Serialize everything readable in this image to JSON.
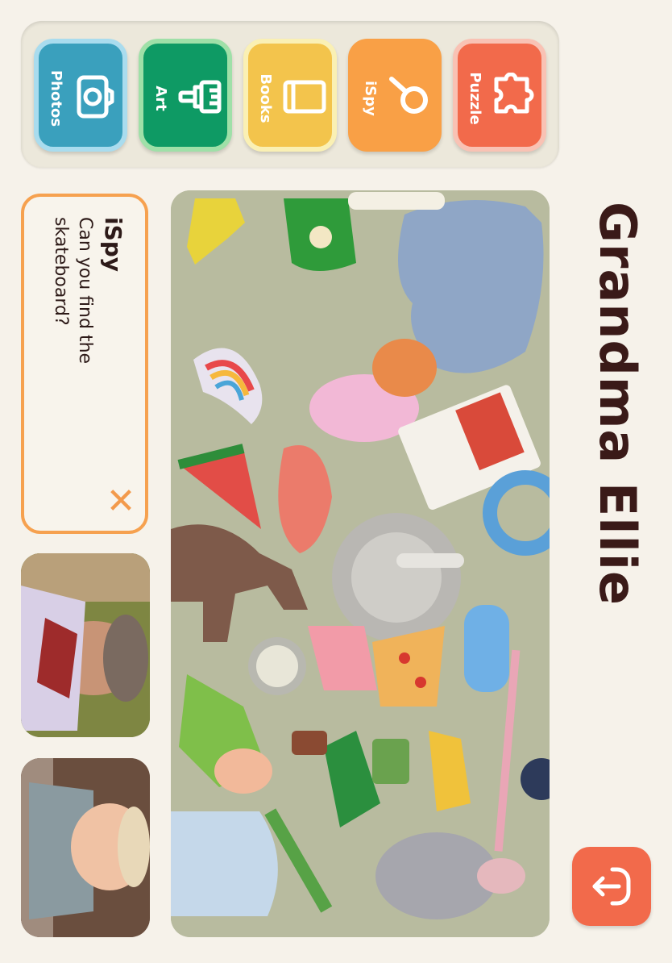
{
  "title": "Grandma Ellie",
  "toolbar": {
    "apps": [
      {
        "label": "Photos",
        "icon": "camera-icon",
        "color": "#3aa0bd",
        "border": "#a9dcee"
      },
      {
        "label": "Art",
        "icon": "paintbrush-icon",
        "color": "#0e9a64",
        "border": "#9fe0a8"
      },
      {
        "label": "Books",
        "icon": "book-icon",
        "color": "#f3c44c",
        "border": "#faf0b4"
      },
      {
        "label": "iSpy",
        "icon": "magnifier-icon",
        "color": "#f9a046",
        "border": "#f9a046"
      },
      {
        "label": "Puzzle",
        "icon": "puzzle-icon",
        "color": "#f26a4b",
        "border": "#f9c2b4"
      }
    ]
  },
  "ispy": {
    "title": "iSpy",
    "question": "Can you find the skateboard?",
    "close_icon": "close-icon",
    "accent": "#f6a14f"
  },
  "scene": {
    "description_icon": "toy-collage-image"
  },
  "videos": {
    "grandma": "video-grandma",
    "child": "video-child"
  },
  "exit": {
    "icon": "exit-icon",
    "color": "#f26a4b"
  }
}
